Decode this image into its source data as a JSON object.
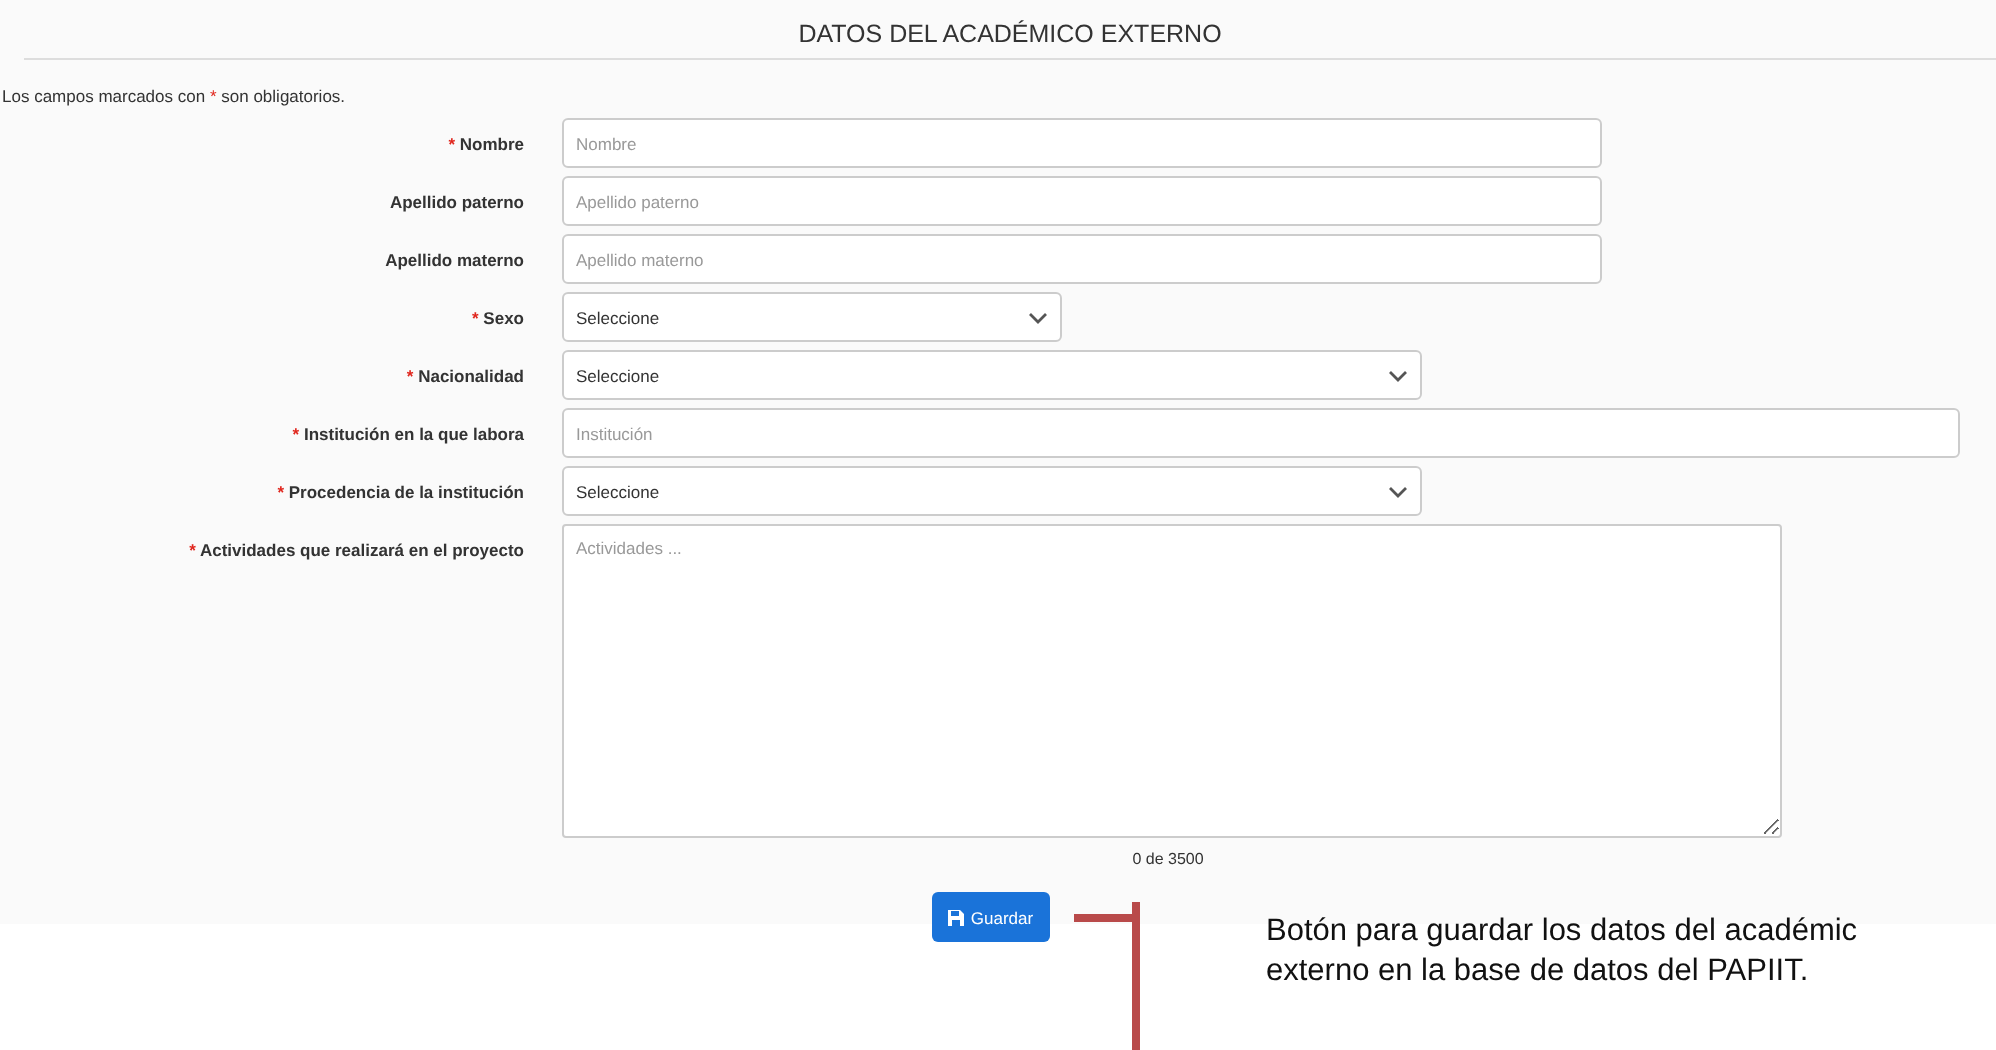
{
  "title": "DATOS DEL ACADÉMICO EXTERNO",
  "required_mark": "*",
  "note": {
    "before": "Los campos marcados con",
    "after": "son obligatorios."
  },
  "fields": [
    {
      "label": "Nombre",
      "required": true,
      "kind": "text",
      "placeholder": "Nombre"
    },
    {
      "label": "Apellido paterno",
      "required": false,
      "kind": "text",
      "placeholder": "Apellido paterno"
    },
    {
      "label": "Apellido materno",
      "required": false,
      "kind": "text",
      "placeholder": "Apellido materno"
    },
    {
      "label": "Sexo",
      "required": true,
      "kind": "select",
      "value": "Seleccione"
    },
    {
      "label": "Nacionalidad",
      "required": true,
      "kind": "select",
      "value": "Seleccione"
    },
    {
      "label": "Institución en la que labora",
      "required": true,
      "kind": "text",
      "placeholder": "Institución"
    },
    {
      "label": "Procedencia de la institución",
      "required": true,
      "kind": "select",
      "value": "Seleccione"
    },
    {
      "label": "Actividades que realizará en el proyecto",
      "required": true,
      "kind": "textarea",
      "placeholder": "Actividades ..."
    }
  ],
  "counter": "0 de 3500",
  "save_button": "Guardar",
  "annotation": [
    "Botón para guardar los datos del académic",
    "externo en la base de datos del PAPIIT."
  ]
}
